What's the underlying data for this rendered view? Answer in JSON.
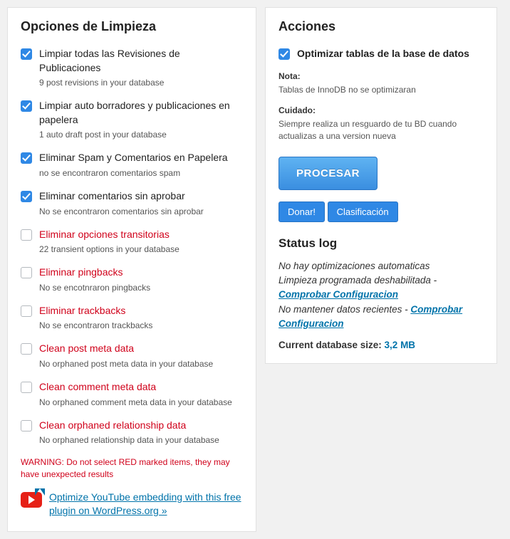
{
  "left": {
    "title": "Opciones de Limpieza",
    "options": [
      {
        "label": "Limpiar todas las Revisiones de Publicaciones",
        "desc": "9 post revisions in your database",
        "checked": true,
        "red": false
      },
      {
        "label": "Limpiar auto borradores y publicaciones en papelera",
        "desc": "1 auto draft post in your database",
        "checked": true,
        "red": false
      },
      {
        "label": "Eliminar Spam y Comentarios en Papelera",
        "desc": "no se encontraron comentarios spam",
        "checked": true,
        "red": false
      },
      {
        "label": "Eliminar comentarios sin aprobar",
        "desc": "No se encontraron comentarios sin aprobar",
        "checked": true,
        "red": false
      },
      {
        "label": "Eliminar opciones transitorias",
        "desc": "22 transient options in your database",
        "checked": false,
        "red": true
      },
      {
        "label": "Eliminar pingbacks",
        "desc": "No se encotnraron pingbacks",
        "checked": false,
        "red": true
      },
      {
        "label": "Eliminar trackbacks",
        "desc": "No se encontraron trackbacks",
        "checked": false,
        "red": true
      },
      {
        "label": "Clean post meta data",
        "desc": "No orphaned post meta data in your database",
        "checked": false,
        "red": true
      },
      {
        "label": "Clean comment meta data",
        "desc": "No orphaned comment meta data in your database",
        "checked": false,
        "red": true
      },
      {
        "label": "Clean orphaned relationship data",
        "desc": "No orphaned relationship data in your database",
        "checked": false,
        "red": true
      }
    ],
    "warning": "WARNING: Do not select RED marked items, they may have unexpected results",
    "promo_link": "Optimize YouTube embedding with this free plugin on WordPress.org »"
  },
  "right": {
    "title": "Acciones",
    "optimize_label": "Optimizar tablas de la base de datos",
    "note_label": "Nota:",
    "note_text": "Tablas de InnoDB no se optimizaran",
    "caution_label": "Cuidado:",
    "caution_text": "Siempre realiza un resguardo de tu BD cuando actualizas a una version nueva",
    "btn_procesar": "PROCESAR",
    "btn_donar": "Donar!",
    "btn_clasif": "Clasificación",
    "status_title": "Status log",
    "status_line1": "No hay optimizaciones automaticas",
    "status_line2_a": "Limpieza programada deshabilitada - ",
    "status_line2_link": "Comprobar Configuracion",
    "status_line3_a": "No mantener datos recientes - ",
    "status_line3_link": "Comprobar Configuracion",
    "db_size_label": "Current database size: ",
    "db_size_value": "3,2 MB"
  }
}
